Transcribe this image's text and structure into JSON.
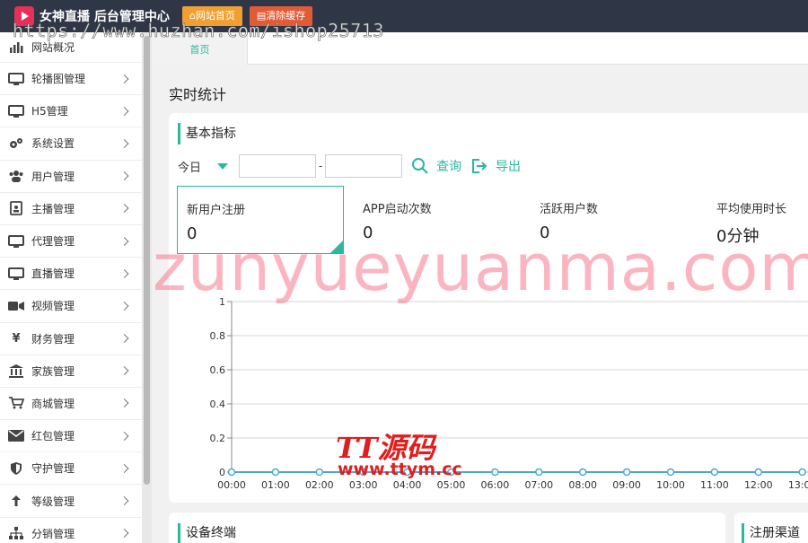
{
  "header": {
    "brand": "女神直播 后台管理中心",
    "home_button": "网站首页",
    "clear_cache_button": "清除缓存"
  },
  "watermarks": {
    "url_overlay": "https://www.huzhan.com/ishop25713",
    "big_text": "zunyueyuanma.com",
    "tt_logo": "TT源码",
    "tt_url": "www.ttym.cc"
  },
  "sidebar": {
    "items": [
      {
        "label": "网站概况",
        "icon": "bar-chart-icon"
      },
      {
        "label": "轮播图管理",
        "icon": "monitor-icon"
      },
      {
        "label": "H5管理",
        "icon": "monitor-icon"
      },
      {
        "label": "系统设置",
        "icon": "gears-icon"
      },
      {
        "label": "用户管理",
        "icon": "users-icon"
      },
      {
        "label": "主播管理",
        "icon": "id-badge-icon"
      },
      {
        "label": "代理管理",
        "icon": "monitor-icon"
      },
      {
        "label": "直播管理",
        "icon": "monitor-icon"
      },
      {
        "label": "视频管理",
        "icon": "video-camera-icon"
      },
      {
        "label": "财务管理",
        "icon": "yen-icon"
      },
      {
        "label": "家族管理",
        "icon": "bank-icon"
      },
      {
        "label": "商城管理",
        "icon": "cart-icon"
      },
      {
        "label": "红包管理",
        "icon": "envelope-icon"
      },
      {
        "label": "守护管理",
        "icon": "shield-icon"
      },
      {
        "label": "等级管理",
        "icon": "arrow-up-icon"
      },
      {
        "label": "分销管理",
        "icon": "sitemap-icon"
      }
    ]
  },
  "tabs": {
    "home": "首页"
  },
  "main": {
    "page_title": "实时统计",
    "basic_section_title": "基本指标",
    "filter": {
      "period": "今日",
      "separator": "-",
      "query": "查询",
      "export": "导出"
    },
    "metrics": [
      {
        "label": "新用户注册",
        "value": "0"
      },
      {
        "label": "APP启动次数",
        "value": "0"
      },
      {
        "label": "活跃用户数",
        "value": "0"
      },
      {
        "label": "平均使用时长",
        "value": "0分钟"
      }
    ],
    "devices_title": "设备终端",
    "channels_title": "注册渠道"
  },
  "colors": {
    "accent": "#2ab8a0",
    "header_bg": "#2f3746",
    "line": "#4aa8d8",
    "home_btn": "#f0a030",
    "clear_btn": "#e35a36"
  },
  "chart_data": {
    "type": "line",
    "x": [
      "00:00",
      "01:00",
      "02:00",
      "03:00",
      "04:00",
      "05:00",
      "06:00",
      "07:00",
      "08:00",
      "09:00",
      "10:00",
      "11:00",
      "12:00",
      "13:00"
    ],
    "y_ticks": [
      "0",
      "0.2",
      "0.4",
      "0.6",
      "0.8",
      "1"
    ],
    "ylim": [
      0,
      1
    ],
    "grid": true,
    "series": [
      {
        "values": [
          0,
          0,
          0,
          0,
          0,
          0,
          0,
          0,
          0,
          0,
          0,
          0,
          0,
          0
        ]
      }
    ]
  }
}
